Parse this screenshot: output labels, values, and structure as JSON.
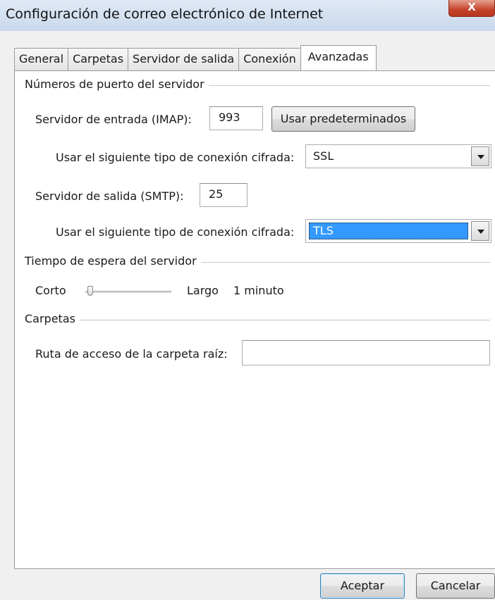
{
  "window": {
    "title": "Configuración de correo electrónico de Internet",
    "close_glyph": "X"
  },
  "tabs": [
    {
      "label": "General",
      "active": false
    },
    {
      "label": "Carpetas",
      "active": false
    },
    {
      "label": "Servidor de salida",
      "active": false
    },
    {
      "label": "Conexión",
      "active": false
    },
    {
      "label": "Avanzadas",
      "active": true
    }
  ],
  "ports": {
    "group_title": "Números de puerto del servidor",
    "incoming_label": "Servidor de entrada (IMAP):",
    "incoming_value": "993",
    "defaults_button": "Usar predeterminados",
    "incoming_encryption_label": "Usar el siguiente tipo de conexión cifrada:",
    "incoming_encryption_value": "SSL",
    "outgoing_label": "Servidor de salida (SMTP):",
    "outgoing_value": "25",
    "outgoing_encryption_label": "Usar el siguiente tipo de conexión cifrada:",
    "outgoing_encryption_value": "TLS"
  },
  "timeout": {
    "group_title": "Tiempo de espera del servidor",
    "min_label": "Corto",
    "max_label": "Largo",
    "value_text": "1 minuto",
    "slider_level": 0.03
  },
  "folders": {
    "group_title": "Carpetas",
    "root_path_label": "Ruta de acceso de la carpeta raíz:",
    "root_path_value": ""
  },
  "footer": {
    "ok_label": "Aceptar",
    "cancel_label": "Cancelar"
  },
  "colors": {
    "selection": "#3399ff",
    "close_button": "#c4422b"
  }
}
